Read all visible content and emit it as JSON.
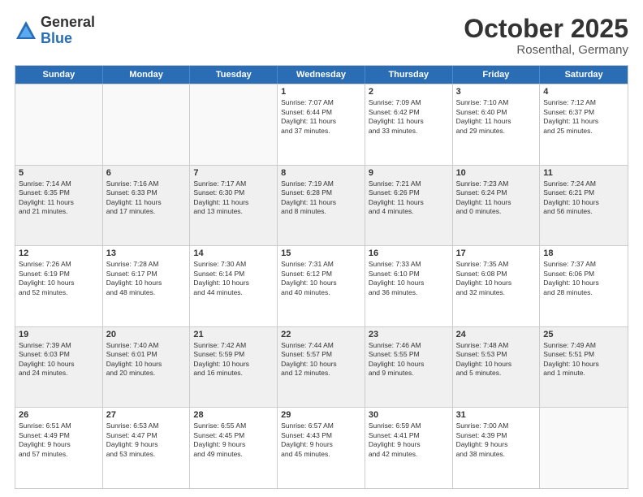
{
  "logo": {
    "general": "General",
    "blue": "Blue"
  },
  "title": "October 2025",
  "subtitle": "Rosenthal, Germany",
  "days": [
    "Sunday",
    "Monday",
    "Tuesday",
    "Wednesday",
    "Thursday",
    "Friday",
    "Saturday"
  ],
  "weeks": [
    [
      {
        "day": "",
        "info": ""
      },
      {
        "day": "",
        "info": ""
      },
      {
        "day": "",
        "info": ""
      },
      {
        "day": "1",
        "info": "Sunrise: 7:07 AM\nSunset: 6:44 PM\nDaylight: 11 hours\nand 37 minutes."
      },
      {
        "day": "2",
        "info": "Sunrise: 7:09 AM\nSunset: 6:42 PM\nDaylight: 11 hours\nand 33 minutes."
      },
      {
        "day": "3",
        "info": "Sunrise: 7:10 AM\nSunset: 6:40 PM\nDaylight: 11 hours\nand 29 minutes."
      },
      {
        "day": "4",
        "info": "Sunrise: 7:12 AM\nSunset: 6:37 PM\nDaylight: 11 hours\nand 25 minutes."
      }
    ],
    [
      {
        "day": "5",
        "info": "Sunrise: 7:14 AM\nSunset: 6:35 PM\nDaylight: 11 hours\nand 21 minutes."
      },
      {
        "day": "6",
        "info": "Sunrise: 7:16 AM\nSunset: 6:33 PM\nDaylight: 11 hours\nand 17 minutes."
      },
      {
        "day": "7",
        "info": "Sunrise: 7:17 AM\nSunset: 6:30 PM\nDaylight: 11 hours\nand 13 minutes."
      },
      {
        "day": "8",
        "info": "Sunrise: 7:19 AM\nSunset: 6:28 PM\nDaylight: 11 hours\nand 8 minutes."
      },
      {
        "day": "9",
        "info": "Sunrise: 7:21 AM\nSunset: 6:26 PM\nDaylight: 11 hours\nand 4 minutes."
      },
      {
        "day": "10",
        "info": "Sunrise: 7:23 AM\nSunset: 6:24 PM\nDaylight: 11 hours\nand 0 minutes."
      },
      {
        "day": "11",
        "info": "Sunrise: 7:24 AM\nSunset: 6:21 PM\nDaylight: 10 hours\nand 56 minutes."
      }
    ],
    [
      {
        "day": "12",
        "info": "Sunrise: 7:26 AM\nSunset: 6:19 PM\nDaylight: 10 hours\nand 52 minutes."
      },
      {
        "day": "13",
        "info": "Sunrise: 7:28 AM\nSunset: 6:17 PM\nDaylight: 10 hours\nand 48 minutes."
      },
      {
        "day": "14",
        "info": "Sunrise: 7:30 AM\nSunset: 6:14 PM\nDaylight: 10 hours\nand 44 minutes."
      },
      {
        "day": "15",
        "info": "Sunrise: 7:31 AM\nSunset: 6:12 PM\nDaylight: 10 hours\nand 40 minutes."
      },
      {
        "day": "16",
        "info": "Sunrise: 7:33 AM\nSunset: 6:10 PM\nDaylight: 10 hours\nand 36 minutes."
      },
      {
        "day": "17",
        "info": "Sunrise: 7:35 AM\nSunset: 6:08 PM\nDaylight: 10 hours\nand 32 minutes."
      },
      {
        "day": "18",
        "info": "Sunrise: 7:37 AM\nSunset: 6:06 PM\nDaylight: 10 hours\nand 28 minutes."
      }
    ],
    [
      {
        "day": "19",
        "info": "Sunrise: 7:39 AM\nSunset: 6:03 PM\nDaylight: 10 hours\nand 24 minutes."
      },
      {
        "day": "20",
        "info": "Sunrise: 7:40 AM\nSunset: 6:01 PM\nDaylight: 10 hours\nand 20 minutes."
      },
      {
        "day": "21",
        "info": "Sunrise: 7:42 AM\nSunset: 5:59 PM\nDaylight: 10 hours\nand 16 minutes."
      },
      {
        "day": "22",
        "info": "Sunrise: 7:44 AM\nSunset: 5:57 PM\nDaylight: 10 hours\nand 12 minutes."
      },
      {
        "day": "23",
        "info": "Sunrise: 7:46 AM\nSunset: 5:55 PM\nDaylight: 10 hours\nand 9 minutes."
      },
      {
        "day": "24",
        "info": "Sunrise: 7:48 AM\nSunset: 5:53 PM\nDaylight: 10 hours\nand 5 minutes."
      },
      {
        "day": "25",
        "info": "Sunrise: 7:49 AM\nSunset: 5:51 PM\nDaylight: 10 hours\nand 1 minute."
      }
    ],
    [
      {
        "day": "26",
        "info": "Sunrise: 6:51 AM\nSunset: 4:49 PM\nDaylight: 9 hours\nand 57 minutes."
      },
      {
        "day": "27",
        "info": "Sunrise: 6:53 AM\nSunset: 4:47 PM\nDaylight: 9 hours\nand 53 minutes."
      },
      {
        "day": "28",
        "info": "Sunrise: 6:55 AM\nSunset: 4:45 PM\nDaylight: 9 hours\nand 49 minutes."
      },
      {
        "day": "29",
        "info": "Sunrise: 6:57 AM\nSunset: 4:43 PM\nDaylight: 9 hours\nand 45 minutes."
      },
      {
        "day": "30",
        "info": "Sunrise: 6:59 AM\nSunset: 4:41 PM\nDaylight: 9 hours\nand 42 minutes."
      },
      {
        "day": "31",
        "info": "Sunrise: 7:00 AM\nSunset: 4:39 PM\nDaylight: 9 hours\nand 38 minutes."
      },
      {
        "day": "",
        "info": ""
      }
    ]
  ]
}
